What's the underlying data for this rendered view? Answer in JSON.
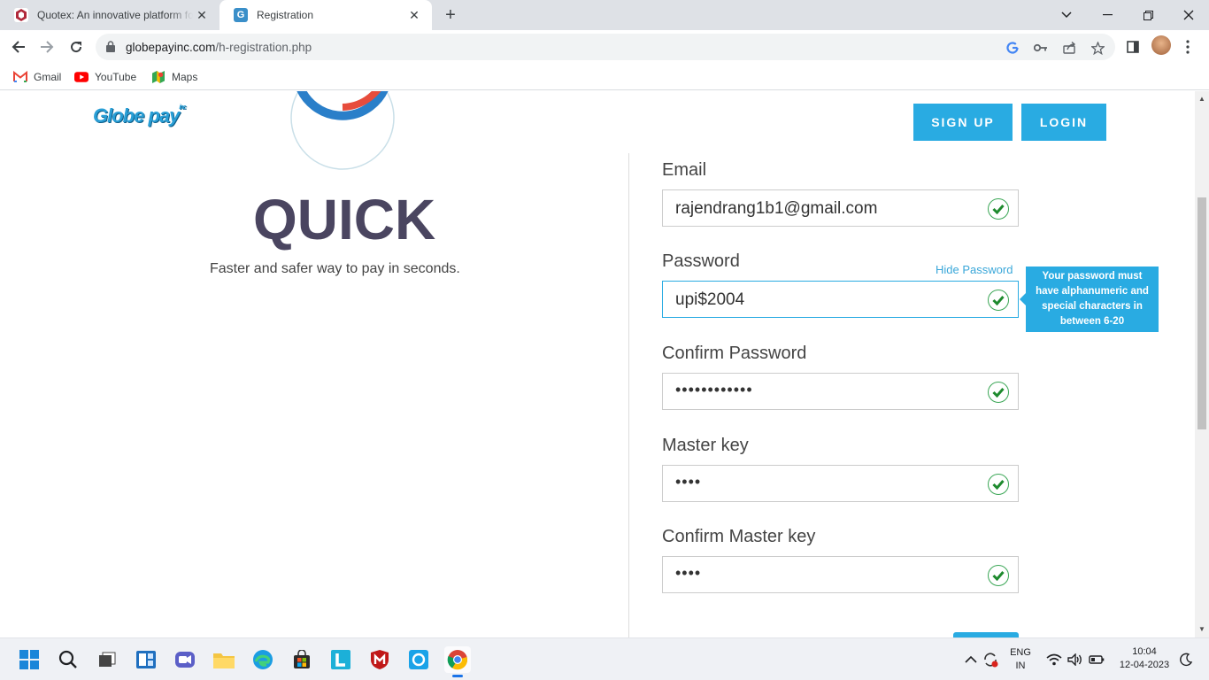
{
  "browser": {
    "tabs": [
      {
        "title": "Quotex: An innovative platform fo",
        "active": false
      },
      {
        "title": "Registration",
        "active": true
      }
    ],
    "new_tab_label": "+",
    "url_host": "globepayinc.com",
    "url_path": "/h-registration.php",
    "bookmarks": [
      {
        "label": "Gmail",
        "icon": "gmail-icon"
      },
      {
        "label": "YouTube",
        "icon": "youtube-icon"
      },
      {
        "label": "Maps",
        "icon": "maps-icon"
      }
    ]
  },
  "site": {
    "logo_text": "Globe pay",
    "logo_tm": "inc",
    "signup_label": "SIGN UP",
    "login_label": "LOGIN",
    "hero_title": "QUICK",
    "hero_tagline": "Faster and safer way to pay in seconds."
  },
  "form": {
    "email_label": "Email",
    "email_value": "rajendrang1b1@gmail.com",
    "password_label": "Password",
    "password_value": "upi$2004",
    "hide_password_label": "Hide Password",
    "password_hint": "Your password must have alphanumeric and special characters in between 6-20",
    "confirm_password_label": "Confirm Password",
    "confirm_password_masked": "••••••••••••",
    "master_key_label": "Master key",
    "master_key_masked": "••••",
    "confirm_master_key_label": "Confirm Master key",
    "confirm_master_key_masked": "••••"
  },
  "taskbar": {
    "lang_line1": "ENG",
    "lang_line2": "IN",
    "time": "10:04",
    "date": "12-04-2023"
  },
  "colors": {
    "accent": "#29abe2",
    "hero_text": "#4a4560",
    "valid_check": "#2e9a3e"
  }
}
